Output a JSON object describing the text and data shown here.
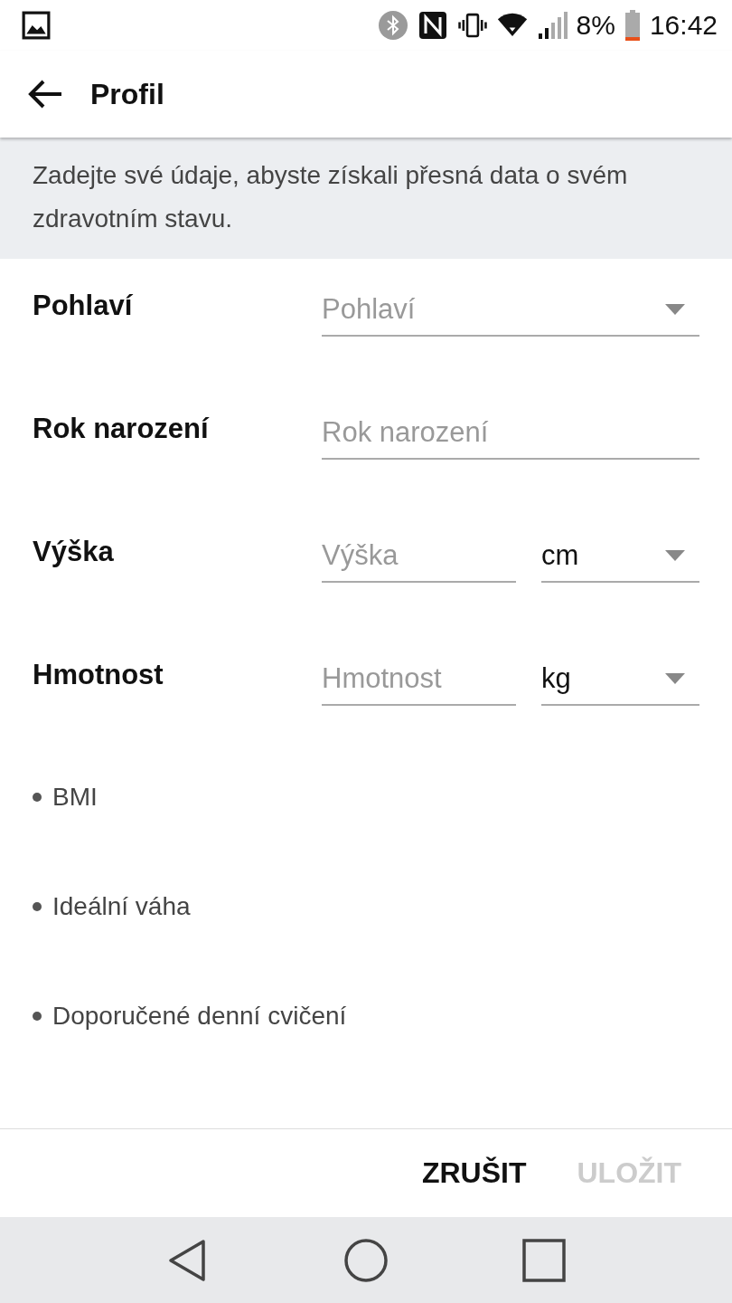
{
  "status_bar": {
    "battery": "8%",
    "time": "16:42"
  },
  "app_bar": {
    "title": "Profil"
  },
  "info": "Zadejte své údaje, abyste získali přesná data o svém zdravotním stavu.",
  "fields": [
    {
      "label": "Pohlaví",
      "kind": "dropdown",
      "placeholder": "Pohlaví"
    },
    {
      "label": "Rok narození",
      "kind": "text",
      "placeholder": "Rok narození"
    },
    {
      "label": "Výška",
      "kind": "text_unit",
      "placeholder": "Výška",
      "unit": "cm"
    },
    {
      "label": "Hmotnost",
      "kind": "text_unit",
      "placeholder": "Hmotnost",
      "unit": "kg"
    }
  ],
  "results": [
    "BMI",
    "Ideální váha",
    "Doporučené denní cvičení"
  ],
  "buttons": [
    {
      "label": "ZRUŠIT",
      "disabled": false
    },
    {
      "label": "ULOŽIT",
      "disabled": true
    }
  ]
}
